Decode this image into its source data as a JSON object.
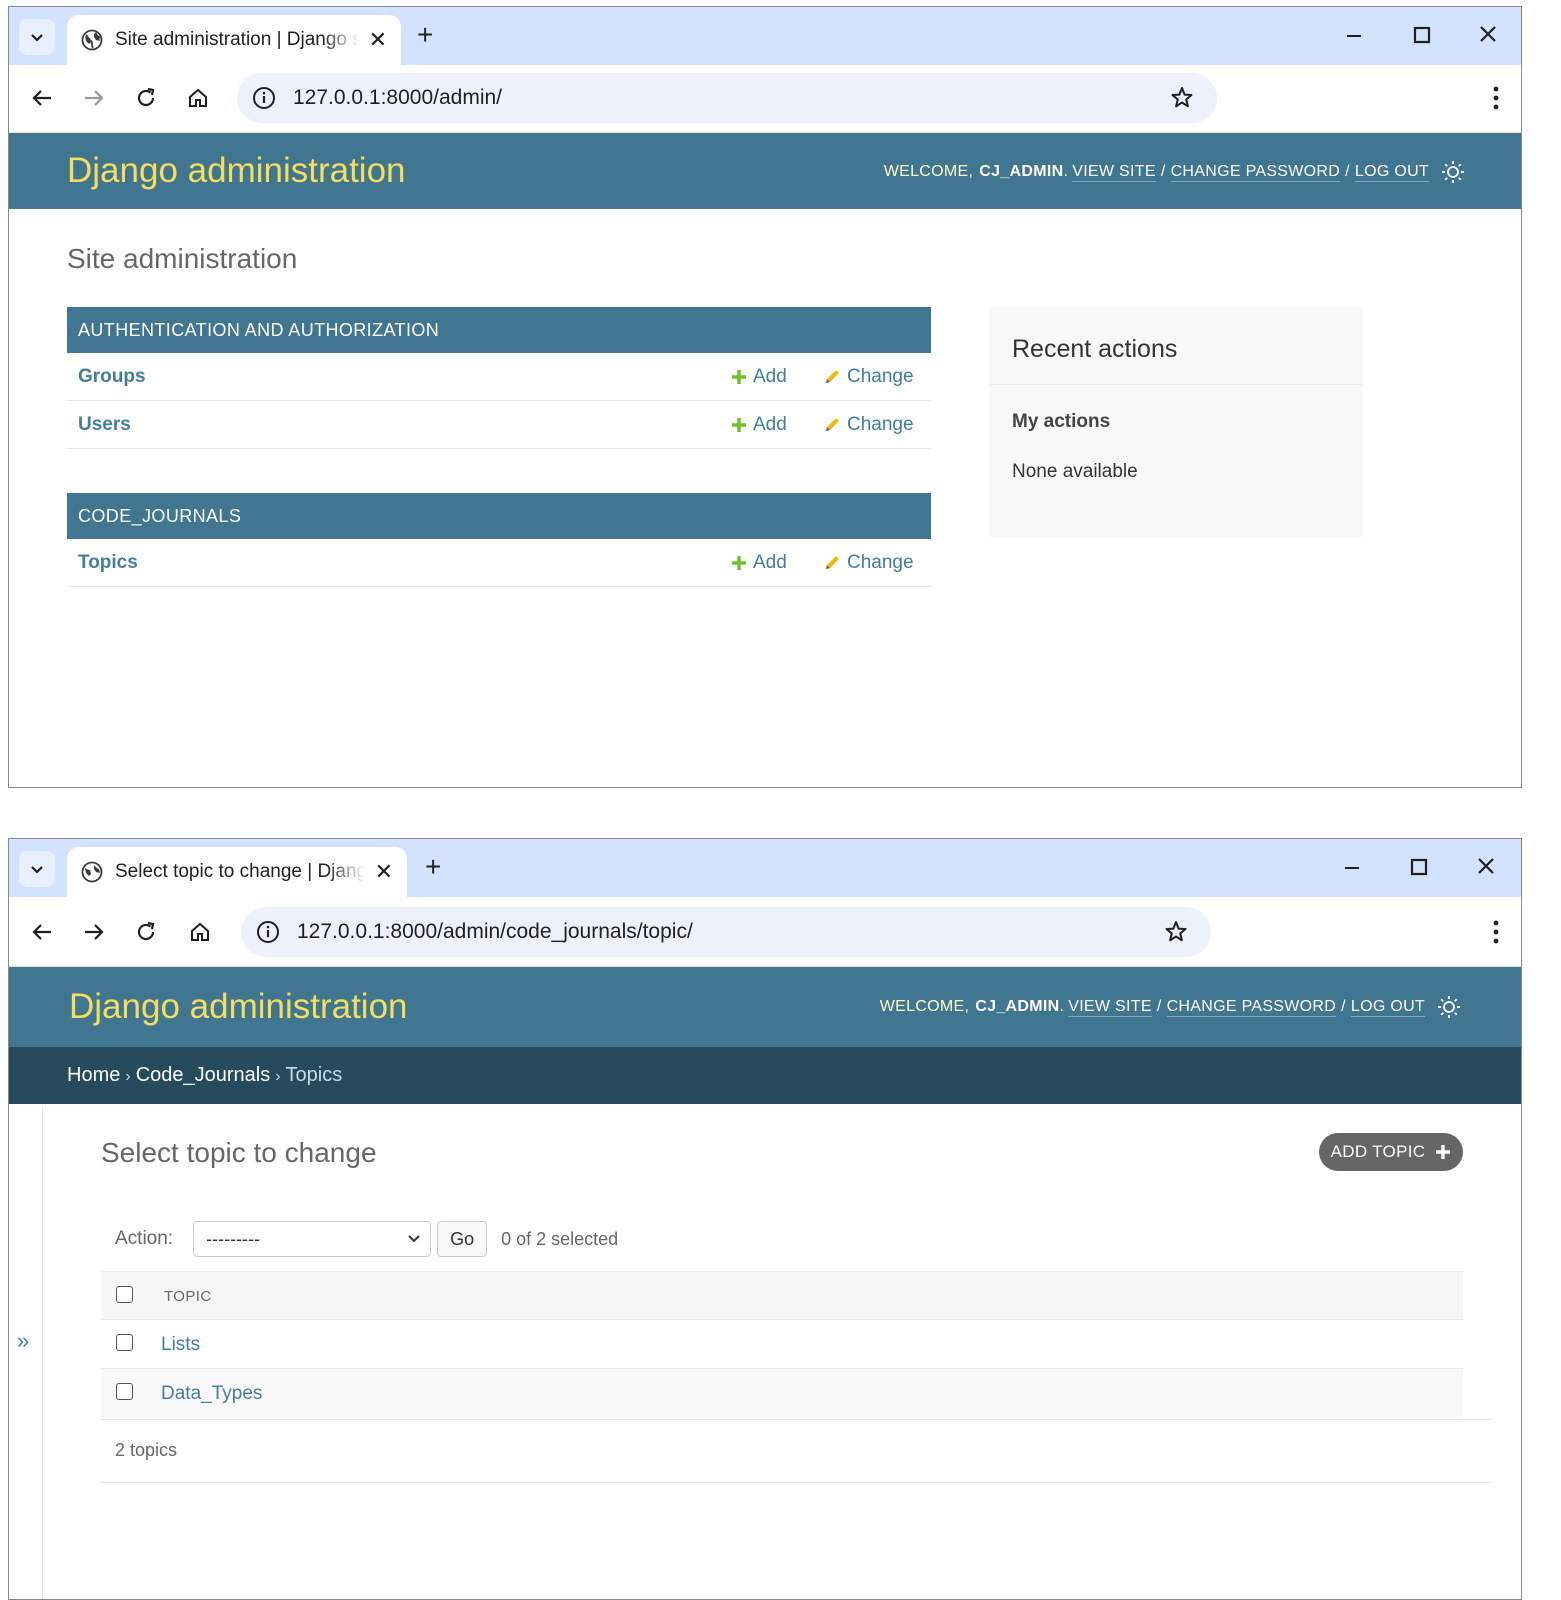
{
  "window1": {
    "tab_title": "Site administration | Django site admin",
    "url": "127.0.0.1:8000/admin/",
    "header": {
      "branding": "Django administration",
      "welcome": "WELCOME,",
      "username": "CJ_ADMIN",
      "view_site": "VIEW SITE",
      "change_password": "CHANGE PASSWORD",
      "log_out": "LOG OUT"
    },
    "page_title": "Site administration",
    "modules": [
      {
        "caption": "AUTHENTICATION AND AUTHORIZATION",
        "rows": [
          {
            "name": "Groups",
            "add": "Add",
            "change": "Change"
          },
          {
            "name": "Users",
            "add": "Add",
            "change": "Change"
          }
        ]
      },
      {
        "caption": "CODE_JOURNALS",
        "rows": [
          {
            "name": "Topics",
            "add": "Add",
            "change": "Change"
          }
        ]
      }
    ],
    "recent_actions": {
      "title": "Recent actions",
      "subtitle": "My actions",
      "empty": "None available"
    }
  },
  "window2": {
    "tab_title": "Select topic to change | Django site admin",
    "url": "127.0.0.1:8000/admin/code_journals/topic/",
    "header": {
      "branding": "Django administration",
      "welcome": "WELCOME,",
      "username": "CJ_ADMIN",
      "view_site": "VIEW SITE",
      "change_password": "CHANGE PASSWORD",
      "log_out": "LOG OUT"
    },
    "breadcrumbs": {
      "home": "Home",
      "app": "Code_Journals",
      "current": "Topics",
      "separator": "›"
    },
    "sidebar_toggle": "»",
    "page_title": "Select topic to change",
    "add_button": "ADD TOPIC",
    "actions": {
      "label": "Action:",
      "selected_value": "---------",
      "go": "Go",
      "counter": "0 of 2 selected"
    },
    "table": {
      "column": "TOPIC",
      "rows": [
        "Lists",
        "Data_Types"
      ]
    },
    "paginator": "2 topics"
  },
  "colors": {
    "header_bg": "#417690",
    "branding": "#f5dd5d",
    "breadcrumbs_bg": "#264b5d",
    "link": "#447e9b",
    "add_green": "#70bf2b",
    "change_yellow": "#efb80b",
    "browser_chrome": "#d3e3fd"
  },
  "icons": {
    "tab_favicon": "globe-icon",
    "tab_list": "chevron-down-icon",
    "close_tab": "close-icon",
    "new_tab": "plus-icon",
    "minimize": "minimize-icon",
    "maximize": "maximize-icon",
    "close_window": "close-icon",
    "back": "back-arrow-icon",
    "forward": "forward-arrow-icon",
    "reload": "reload-icon",
    "home": "home-icon",
    "site_info": "info-icon",
    "bookmark": "star-icon",
    "menu": "kebab-menu-icon",
    "theme_toggle": "sun-icon",
    "add": "plus-icon",
    "change": "pencil-icon"
  }
}
